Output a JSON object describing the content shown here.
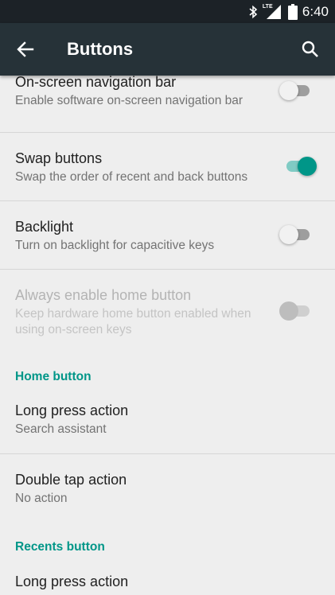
{
  "status_bar": {
    "time": "6:40",
    "network": "LTE",
    "icons": [
      "bluetooth-icon",
      "signal-icon",
      "battery-icon"
    ]
  },
  "app_bar": {
    "title": "Buttons",
    "back_icon": "arrow-left-icon",
    "search_icon": "search-icon"
  },
  "colors": {
    "app_bar": "#263238",
    "status_bar": "#1c2227",
    "accent": "#009688",
    "background": "#eeeeee"
  },
  "settings": {
    "nav_bar": {
      "title": "On-screen navigation bar",
      "summary": "Enable software on-screen navigation bar",
      "enabled": false
    },
    "swap_buttons": {
      "title": "Swap buttons",
      "summary": "Swap the order of recent and back buttons",
      "enabled": true
    },
    "backlight": {
      "title": "Backlight",
      "summary": "Turn on backlight for capacitive keys",
      "enabled": false
    },
    "always_home": {
      "title": "Always enable home button",
      "summary": "Keep hardware home button enabled when using on-screen keys",
      "enabled": false,
      "disabled": true
    }
  },
  "home_button": {
    "header": "Home button",
    "long_press": {
      "title": "Long press action",
      "summary": "Search assistant"
    },
    "double_tap": {
      "title": "Double tap action",
      "summary": "No action"
    }
  },
  "recents_button": {
    "header": "Recents button",
    "long_press": {
      "title": "Long press action"
    }
  }
}
